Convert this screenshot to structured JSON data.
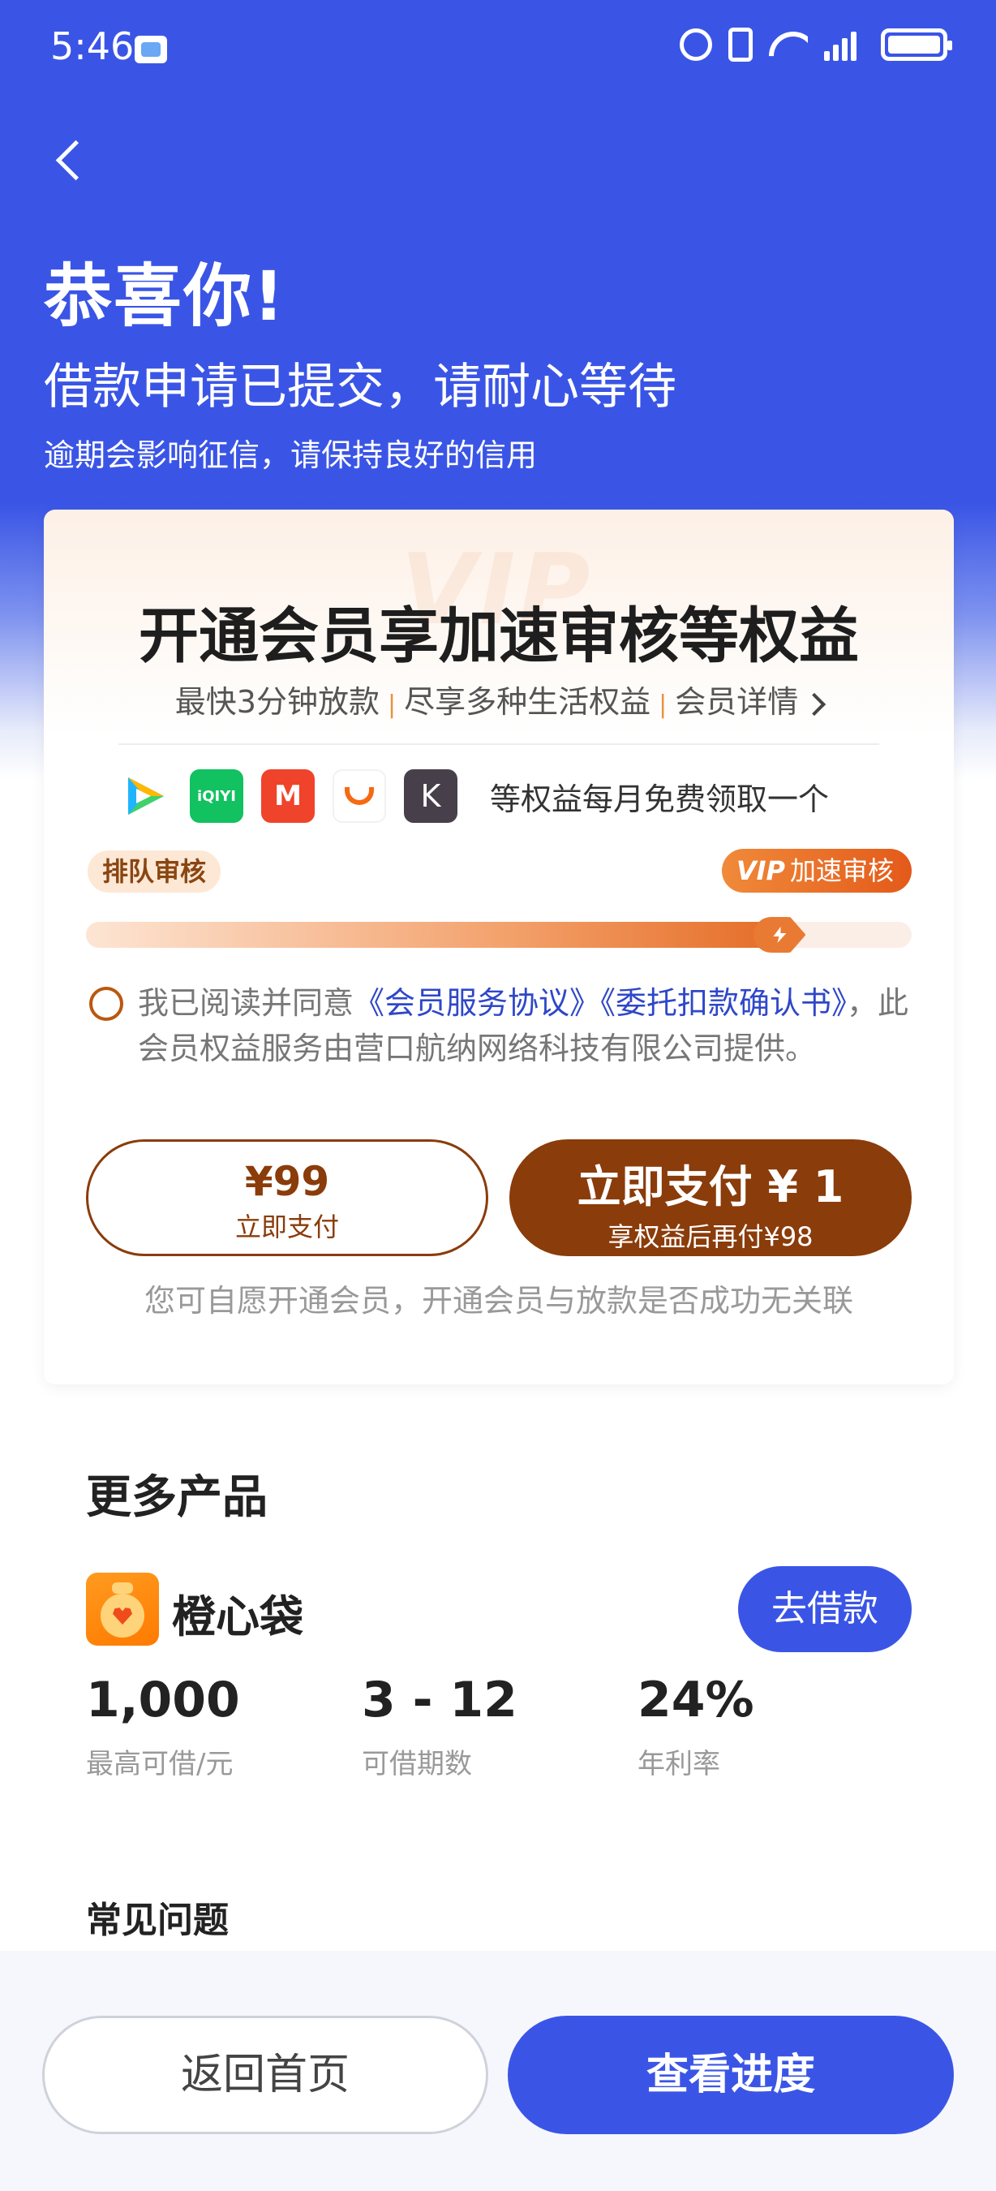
{
  "status_bar": {
    "time": "5:46",
    "icons": [
      "app-notification-icon",
      "alarm-icon",
      "vibrate-icon",
      "wifi-icon",
      "4g-signal-icon",
      "battery-charging-icon"
    ],
    "network": "4G"
  },
  "header": {
    "back_icon": "chevron-left-icon",
    "title": "恭喜你!",
    "subtitle": "借款申请已提交，请耐心等待",
    "note": "逾期会影响征信，请保持良好的信用"
  },
  "member_card": {
    "watermark": "VIP",
    "title": "开通会员享加速审核等权益",
    "features": [
      "最快3分钟放款",
      "尽享多种生活权益",
      "会员详情"
    ],
    "separator": "|",
    "partners": [
      {
        "name": "tencent-video-logo",
        "text": ""
      },
      {
        "name": "iqiyi-logo",
        "text": "iQIYI"
      },
      {
        "name": "mango-tv-logo",
        "text": "M"
      },
      {
        "name": "didi-logo",
        "text": ""
      },
      {
        "name": "keep-logo",
        "text": "K"
      }
    ],
    "partner_text": "等权益每月免费领取一个",
    "queue_label": "排队审核",
    "vip_badge": {
      "prefix": "VIP",
      "label": "加速审核"
    },
    "progress": 0.86,
    "agreement": {
      "prefix": "我已阅读并同意",
      "link1": "《会员服务协议》",
      "link2": "《委托扣款确认书》",
      "suffix": "，此会员权益服务由营口航纳网络科技有限公司提供。",
      "checked": false
    },
    "pay_full": {
      "price": "¥99",
      "label": "立即支付"
    },
    "pay_now": {
      "main": "立即支付 ¥ 1",
      "sub": "享权益后再付¥98"
    },
    "voluntary_note": "您可自愿开通会员，开通会员与放款是否成功无关联"
  },
  "more_products": {
    "title": "更多产品",
    "product": {
      "name": "橙心袋",
      "button": "去借款",
      "stats": [
        {
          "value": "1,000",
          "label": "最高可借/元"
        },
        {
          "value": "3 - 12",
          "label": "可借期数"
        },
        {
          "value": "24%",
          "label": "年利率"
        }
      ]
    }
  },
  "faq": {
    "title": "常见问题"
  },
  "bottom_bar": {
    "home": "返回首页",
    "progress": "查看进度"
  },
  "colors": {
    "primary": "#3a55e6",
    "brown": "#8a3c0a",
    "orange": "#e97a33"
  }
}
